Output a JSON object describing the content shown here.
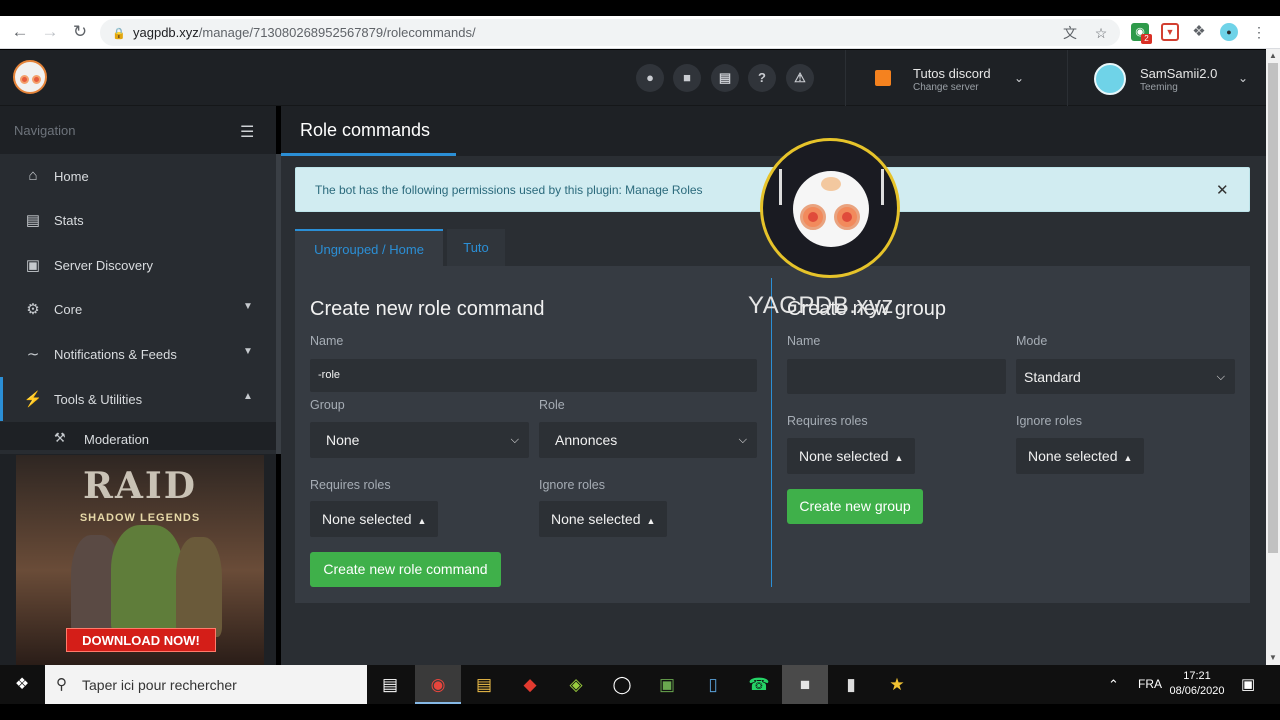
{
  "browser": {
    "url_host": "yagpdb.xyz",
    "url_path": "/manage/713080268952567879/rolecommands/",
    "extension_badge": "2"
  },
  "header": {
    "server_name": "Tutos discord",
    "server_sub": "Change server",
    "user_name": "SamSamii2.0",
    "user_sub": "Teeming"
  },
  "sidebar": {
    "title": "Navigation",
    "items": [
      {
        "label": "Home",
        "icon": "home-icon"
      },
      {
        "label": "Stats",
        "icon": "bar-chart-icon"
      },
      {
        "label": "Server Discovery",
        "icon": "discord-icon"
      },
      {
        "label": "Core",
        "icon": "gears-icon"
      },
      {
        "label": "Notifications & Feeds",
        "icon": "rss-icon"
      },
      {
        "label": "Tools & Utilities",
        "icon": "bolt-icon"
      }
    ],
    "sub_item": "Moderation"
  },
  "ad": {
    "title": "RAID",
    "subtitle": "SHADOW LEGENDS",
    "cta": "DOWNLOAD NOW!"
  },
  "main": {
    "page_title": "Role commands",
    "alert_message": "The bot has the following permissions used by this plugin: Manage Roles",
    "tabs": [
      "Ungrouped / Home",
      "Tuto"
    ],
    "command_form": {
      "heading": "Create new role command",
      "name_label": "Name",
      "name_value": "-role",
      "group_label": "Group",
      "group_value": "None",
      "role_label": "Role",
      "role_value": "Annonces",
      "requires_label": "Requires roles",
      "requires_value": "None selected",
      "ignore_label": "Ignore roles",
      "ignore_value": "None selected",
      "submit": "Create new role command"
    },
    "group_form": {
      "heading": "Create new group",
      "name_label": "Name",
      "name_value": "",
      "mode_label": "Mode",
      "mode_value": "Standard",
      "requires_label": "Requires roles",
      "requires_value": "None selected",
      "ignore_label": "Ignore roles",
      "ignore_value": "None selected",
      "submit": "Create new group"
    }
  },
  "overlay": {
    "watermark": "YAGPDB.xyz"
  },
  "taskbar": {
    "search_placeholder": "Taper ici pour rechercher",
    "language": "FRA",
    "time": "17:21",
    "date": "08/06/2020"
  },
  "colors": {
    "accent": "#2b8fd6",
    "success": "#3fb04a",
    "alert_bg": "#d1ecf1",
    "sidebar_bg": "#1e2125",
    "panel_bg": "#363b42"
  }
}
